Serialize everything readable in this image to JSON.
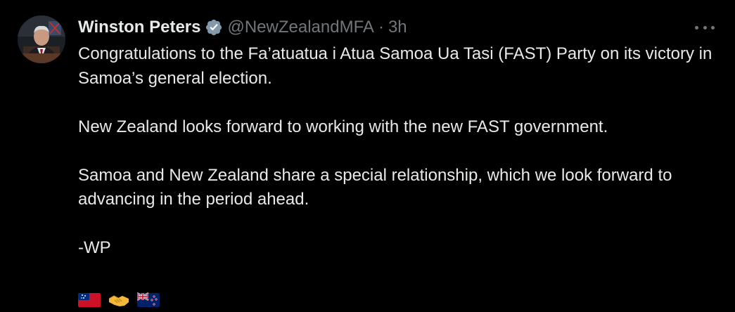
{
  "tweet": {
    "author": {
      "display_name": "Winston Peters",
      "handle": "@NewZealandMFA",
      "verified": true,
      "verified_color": "#829aab"
    },
    "separator": "·",
    "time": "3h",
    "text": {
      "paragraph_1": "Congratulations to the Fa’atuatua i Atua Samoa Ua Tasi (FAST) Party on its victory in Samoa’s general election.",
      "paragraph_2": "New Zealand looks forward to working with the new FAST government.",
      "paragraph_3": "Samoa and New Zealand share a special relationship, which we look forward to advancing in the period ahead.",
      "signature": "-WP"
    },
    "emojis": [
      "flag-samoa",
      "handshake",
      "flag-new-zealand"
    ],
    "more_icon": "more-dots-icon"
  },
  "colors": {
    "background": "#000000",
    "primary_text": "#e7e9ea",
    "secondary_text": "#71767b"
  }
}
